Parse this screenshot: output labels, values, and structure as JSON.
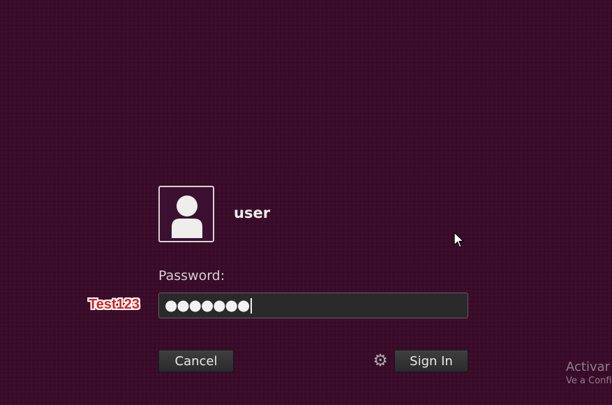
{
  "login": {
    "username": "user",
    "password_label": "Password:",
    "password_masked": "●●●●●●●",
    "cancel_label": "Cancel",
    "signin_label": "Sign In",
    "session_icon": "gear-icon",
    "avatar_icon": "user-silhouette-icon"
  },
  "annotation": {
    "text": "Test123",
    "color": "#e21b1b"
  },
  "watermark": {
    "title": "Activar",
    "subtitle": "Ve a Confi"
  },
  "colors": {
    "background": "#3a0c2a",
    "field_background": "#2a2a2a",
    "button_background": "#333333"
  }
}
